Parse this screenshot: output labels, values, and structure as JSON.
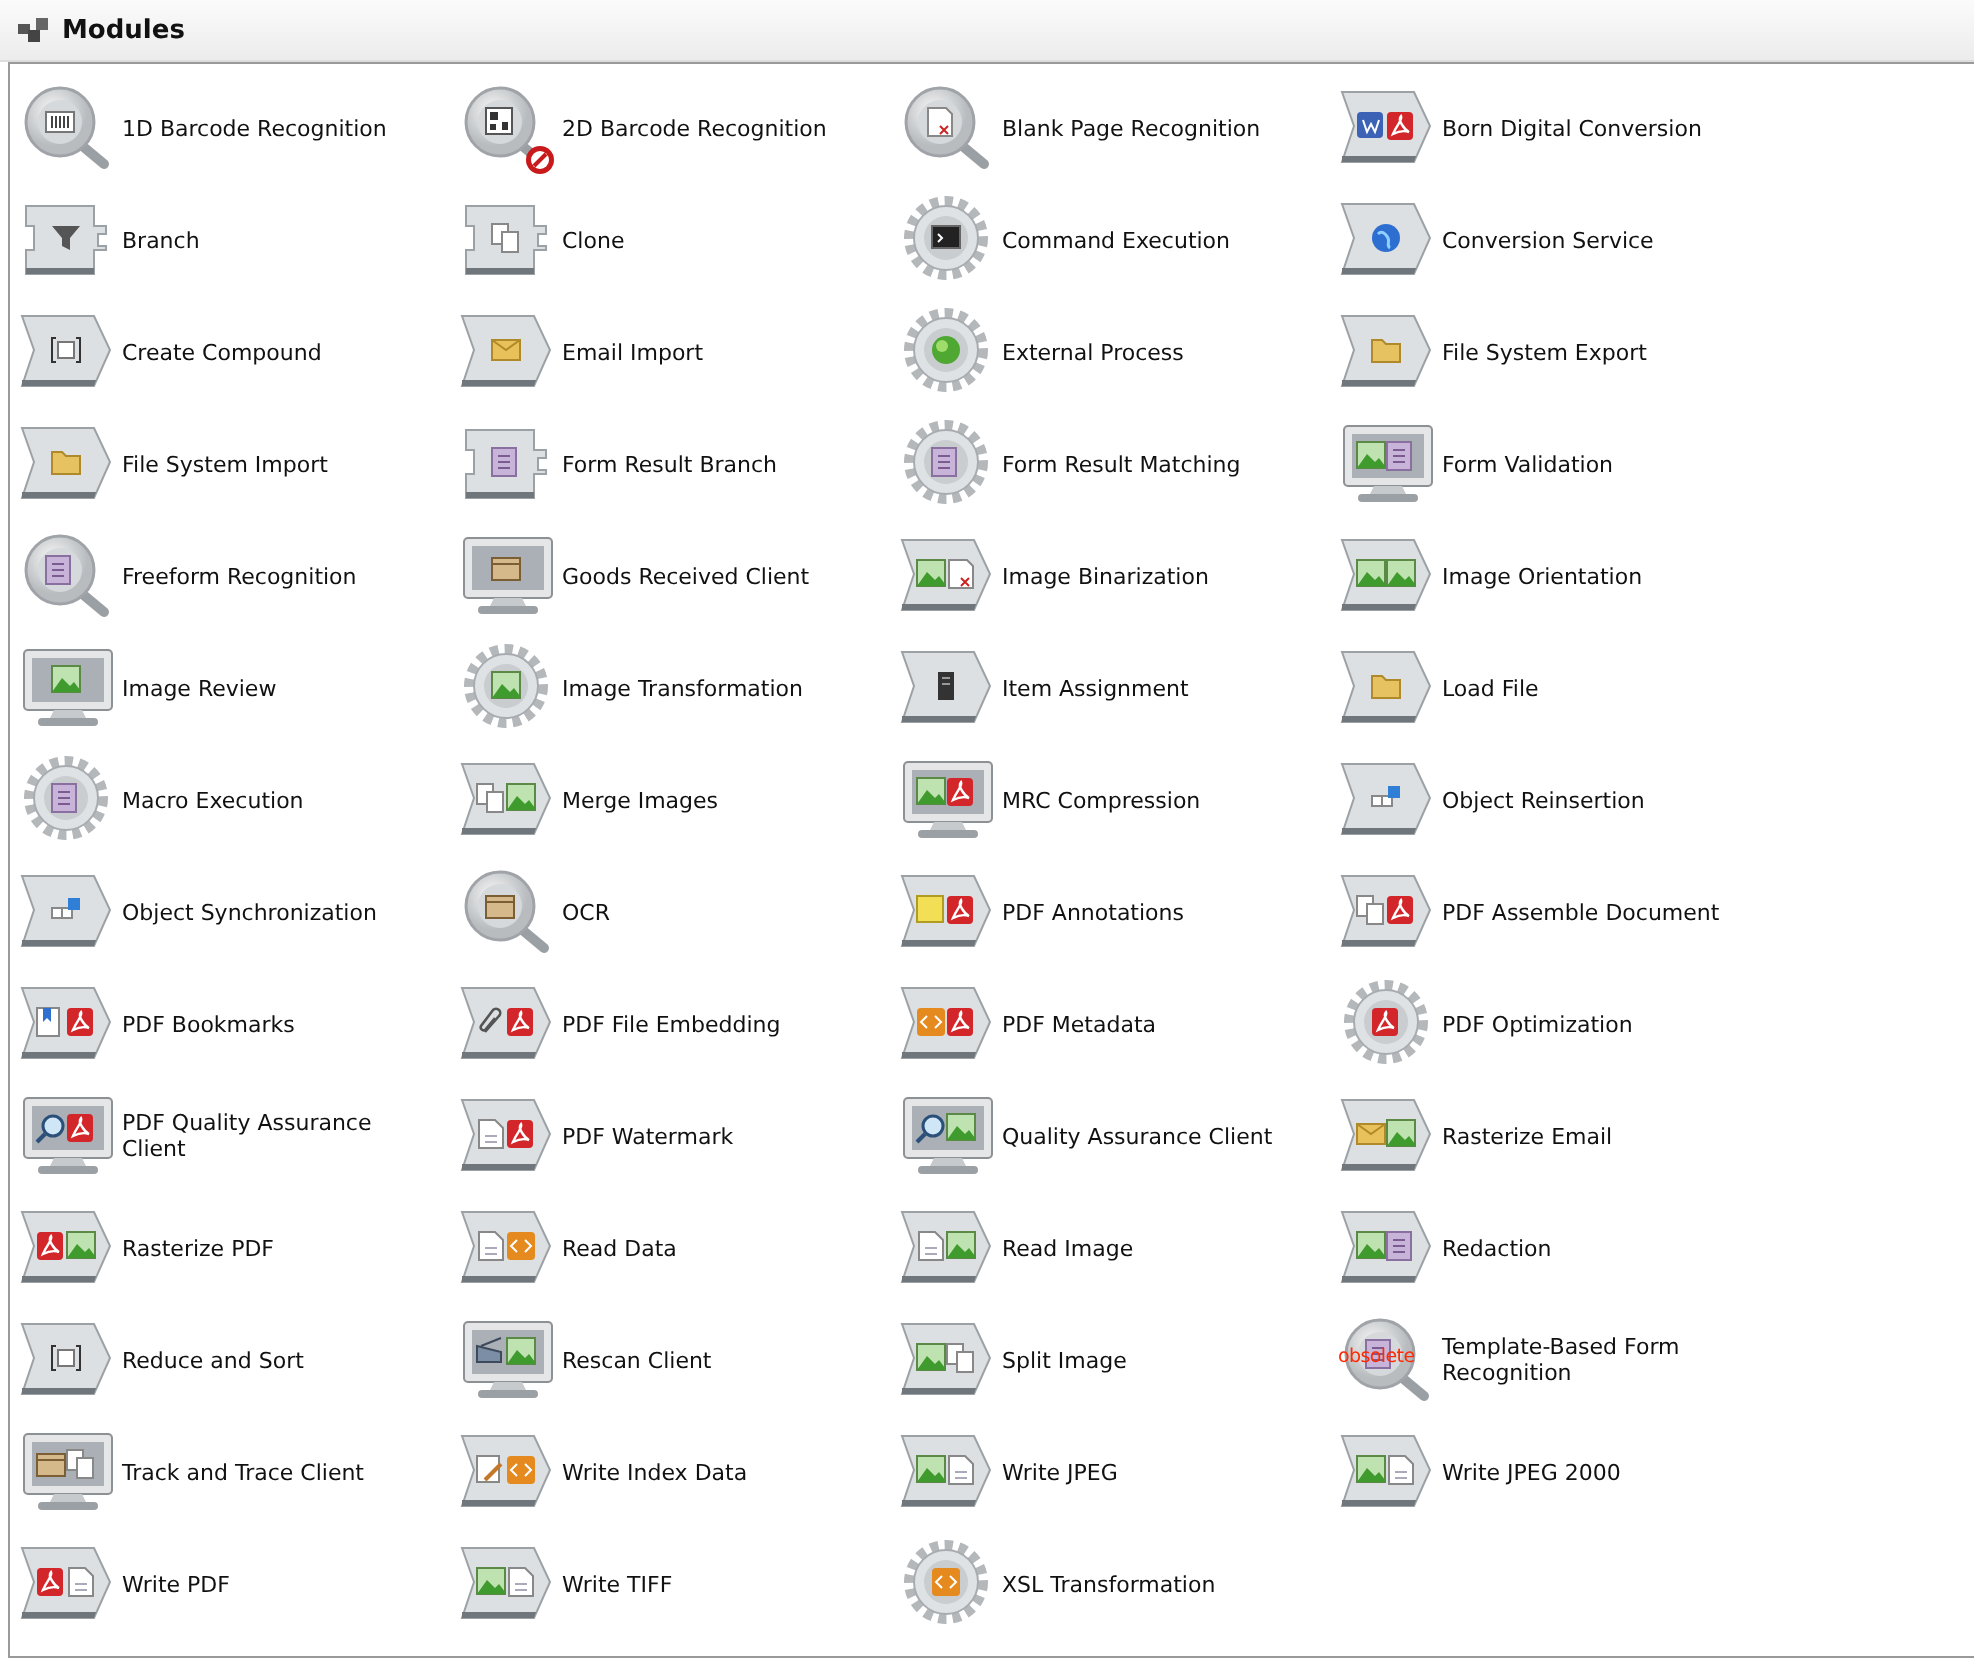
{
  "header": {
    "title": "Modules"
  },
  "modules": [
    {
      "label": "1D Barcode Recognition",
      "kind": "lens"
    },
    {
      "label": "2D Barcode Recognition",
      "kind": "lens"
    },
    {
      "label": "Blank Page Recognition",
      "kind": "lens"
    },
    {
      "label": "Born Digital Conversion",
      "kind": "chevron"
    },
    {
      "label": "Branch",
      "kind": "branch"
    },
    {
      "label": "Clone",
      "kind": "branch"
    },
    {
      "label": "Command Execution",
      "kind": "gear"
    },
    {
      "label": "Conversion Service",
      "kind": "chevron"
    },
    {
      "label": "Create Compound",
      "kind": "chevron"
    },
    {
      "label": "Email Import",
      "kind": "chevron"
    },
    {
      "label": "External Process",
      "kind": "gear"
    },
    {
      "label": "File System Export",
      "kind": "chevron"
    },
    {
      "label": "File System Import",
      "kind": "chevron"
    },
    {
      "label": "Form Result Branch",
      "kind": "branch"
    },
    {
      "label": "Form Result Matching",
      "kind": "gear"
    },
    {
      "label": "Form Validation",
      "kind": "screen"
    },
    {
      "label": "Freeform Recognition",
      "kind": "lens"
    },
    {
      "label": "Goods Received Client",
      "kind": "screen"
    },
    {
      "label": "Image Binarization",
      "kind": "chevron"
    },
    {
      "label": "Image Orientation",
      "kind": "chevron"
    },
    {
      "label": "Image Review",
      "kind": "screen"
    },
    {
      "label": "Image Transformation",
      "kind": "gear"
    },
    {
      "label": "Item Assignment",
      "kind": "chevron"
    },
    {
      "label": "Load File",
      "kind": "chevron"
    },
    {
      "label": "Macro Execution",
      "kind": "gear"
    },
    {
      "label": "Merge Images",
      "kind": "chevron"
    },
    {
      "label": "MRC Compression",
      "kind": "screen"
    },
    {
      "label": "Object Reinsertion",
      "kind": "chevron"
    },
    {
      "label": "Object Synchronization",
      "kind": "chevron"
    },
    {
      "label": "OCR",
      "kind": "lens"
    },
    {
      "label": "PDF Annotations",
      "kind": "chevron"
    },
    {
      "label": "PDF Assemble Document",
      "kind": "chevron"
    },
    {
      "label": "PDF Bookmarks",
      "kind": "chevron"
    },
    {
      "label": "PDF File Embedding",
      "kind": "chevron"
    },
    {
      "label": "PDF Metadata",
      "kind": "chevron"
    },
    {
      "label": "PDF Optimization",
      "kind": "gear"
    },
    {
      "label": "PDF Quality Assurance Client",
      "kind": "screen"
    },
    {
      "label": "PDF Watermark",
      "kind": "chevron"
    },
    {
      "label": "Quality Assurance Client",
      "kind": "screen"
    },
    {
      "label": "Rasterize Email",
      "kind": "chevron"
    },
    {
      "label": "Rasterize PDF",
      "kind": "chevron"
    },
    {
      "label": "Read Data",
      "kind": "chevron"
    },
    {
      "label": "Read Image",
      "kind": "chevron"
    },
    {
      "label": "Redaction",
      "kind": "chevron"
    },
    {
      "label": "Reduce and Sort",
      "kind": "chevron"
    },
    {
      "label": "Rescan Client",
      "kind": "screen"
    },
    {
      "label": "Split Image",
      "kind": "chevron"
    },
    {
      "label": "Template-Based Form Recognition",
      "kind": "lens",
      "overlay": "obsolete"
    },
    {
      "label": "Track and Trace Client",
      "kind": "screen"
    },
    {
      "label": "Write Index Data",
      "kind": "chevron"
    },
    {
      "label": "Write JPEG",
      "kind": "chevron"
    },
    {
      "label": "Write JPEG 2000",
      "kind": "chevron"
    },
    {
      "label": "Write PDF",
      "kind": "chevron"
    },
    {
      "label": "Write TIFF",
      "kind": "chevron"
    },
    {
      "label": "XSL Transformation",
      "kind": "gear"
    }
  ]
}
